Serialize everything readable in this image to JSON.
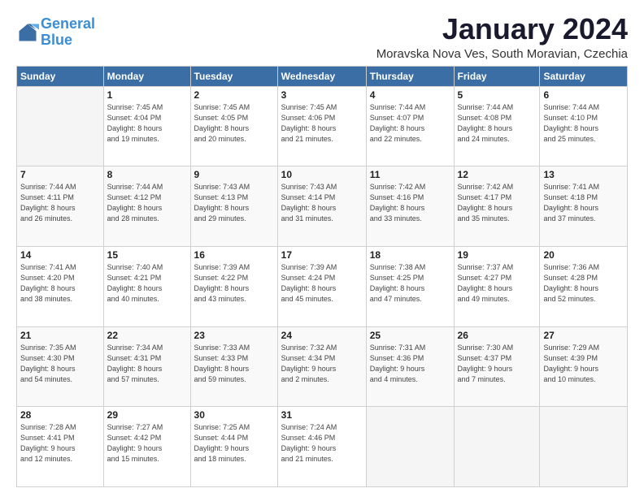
{
  "logo": {
    "line1": "General",
    "line2": "Blue"
  },
  "title": "January 2024",
  "subtitle": "Moravska Nova Ves, South Moravian, Czechia",
  "days_header": [
    "Sunday",
    "Monday",
    "Tuesday",
    "Wednesday",
    "Thursday",
    "Friday",
    "Saturday"
  ],
  "weeks": [
    [
      {
        "day": "",
        "info": ""
      },
      {
        "day": "1",
        "info": "Sunrise: 7:45 AM\nSunset: 4:04 PM\nDaylight: 8 hours\nand 19 minutes."
      },
      {
        "day": "2",
        "info": "Sunrise: 7:45 AM\nSunset: 4:05 PM\nDaylight: 8 hours\nand 20 minutes."
      },
      {
        "day": "3",
        "info": "Sunrise: 7:45 AM\nSunset: 4:06 PM\nDaylight: 8 hours\nand 21 minutes."
      },
      {
        "day": "4",
        "info": "Sunrise: 7:44 AM\nSunset: 4:07 PM\nDaylight: 8 hours\nand 22 minutes."
      },
      {
        "day": "5",
        "info": "Sunrise: 7:44 AM\nSunset: 4:08 PM\nDaylight: 8 hours\nand 24 minutes."
      },
      {
        "day": "6",
        "info": "Sunrise: 7:44 AM\nSunset: 4:10 PM\nDaylight: 8 hours\nand 25 minutes."
      }
    ],
    [
      {
        "day": "7",
        "info": "Sunrise: 7:44 AM\nSunset: 4:11 PM\nDaylight: 8 hours\nand 26 minutes."
      },
      {
        "day": "8",
        "info": "Sunrise: 7:44 AM\nSunset: 4:12 PM\nDaylight: 8 hours\nand 28 minutes."
      },
      {
        "day": "9",
        "info": "Sunrise: 7:43 AM\nSunset: 4:13 PM\nDaylight: 8 hours\nand 29 minutes."
      },
      {
        "day": "10",
        "info": "Sunrise: 7:43 AM\nSunset: 4:14 PM\nDaylight: 8 hours\nand 31 minutes."
      },
      {
        "day": "11",
        "info": "Sunrise: 7:42 AM\nSunset: 4:16 PM\nDaylight: 8 hours\nand 33 minutes."
      },
      {
        "day": "12",
        "info": "Sunrise: 7:42 AM\nSunset: 4:17 PM\nDaylight: 8 hours\nand 35 minutes."
      },
      {
        "day": "13",
        "info": "Sunrise: 7:41 AM\nSunset: 4:18 PM\nDaylight: 8 hours\nand 37 minutes."
      }
    ],
    [
      {
        "day": "14",
        "info": "Sunrise: 7:41 AM\nSunset: 4:20 PM\nDaylight: 8 hours\nand 38 minutes."
      },
      {
        "day": "15",
        "info": "Sunrise: 7:40 AM\nSunset: 4:21 PM\nDaylight: 8 hours\nand 40 minutes."
      },
      {
        "day": "16",
        "info": "Sunrise: 7:39 AM\nSunset: 4:22 PM\nDaylight: 8 hours\nand 43 minutes."
      },
      {
        "day": "17",
        "info": "Sunrise: 7:39 AM\nSunset: 4:24 PM\nDaylight: 8 hours\nand 45 minutes."
      },
      {
        "day": "18",
        "info": "Sunrise: 7:38 AM\nSunset: 4:25 PM\nDaylight: 8 hours\nand 47 minutes."
      },
      {
        "day": "19",
        "info": "Sunrise: 7:37 AM\nSunset: 4:27 PM\nDaylight: 8 hours\nand 49 minutes."
      },
      {
        "day": "20",
        "info": "Sunrise: 7:36 AM\nSunset: 4:28 PM\nDaylight: 8 hours\nand 52 minutes."
      }
    ],
    [
      {
        "day": "21",
        "info": "Sunrise: 7:35 AM\nSunset: 4:30 PM\nDaylight: 8 hours\nand 54 minutes."
      },
      {
        "day": "22",
        "info": "Sunrise: 7:34 AM\nSunset: 4:31 PM\nDaylight: 8 hours\nand 57 minutes."
      },
      {
        "day": "23",
        "info": "Sunrise: 7:33 AM\nSunset: 4:33 PM\nDaylight: 8 hours\nand 59 minutes."
      },
      {
        "day": "24",
        "info": "Sunrise: 7:32 AM\nSunset: 4:34 PM\nDaylight: 9 hours\nand 2 minutes."
      },
      {
        "day": "25",
        "info": "Sunrise: 7:31 AM\nSunset: 4:36 PM\nDaylight: 9 hours\nand 4 minutes."
      },
      {
        "day": "26",
        "info": "Sunrise: 7:30 AM\nSunset: 4:37 PM\nDaylight: 9 hours\nand 7 minutes."
      },
      {
        "day": "27",
        "info": "Sunrise: 7:29 AM\nSunset: 4:39 PM\nDaylight: 9 hours\nand 10 minutes."
      }
    ],
    [
      {
        "day": "28",
        "info": "Sunrise: 7:28 AM\nSunset: 4:41 PM\nDaylight: 9 hours\nand 12 minutes."
      },
      {
        "day": "29",
        "info": "Sunrise: 7:27 AM\nSunset: 4:42 PM\nDaylight: 9 hours\nand 15 minutes."
      },
      {
        "day": "30",
        "info": "Sunrise: 7:25 AM\nSunset: 4:44 PM\nDaylight: 9 hours\nand 18 minutes."
      },
      {
        "day": "31",
        "info": "Sunrise: 7:24 AM\nSunset: 4:46 PM\nDaylight: 9 hours\nand 21 minutes."
      },
      {
        "day": "",
        "info": ""
      },
      {
        "day": "",
        "info": ""
      },
      {
        "day": "",
        "info": ""
      }
    ]
  ]
}
